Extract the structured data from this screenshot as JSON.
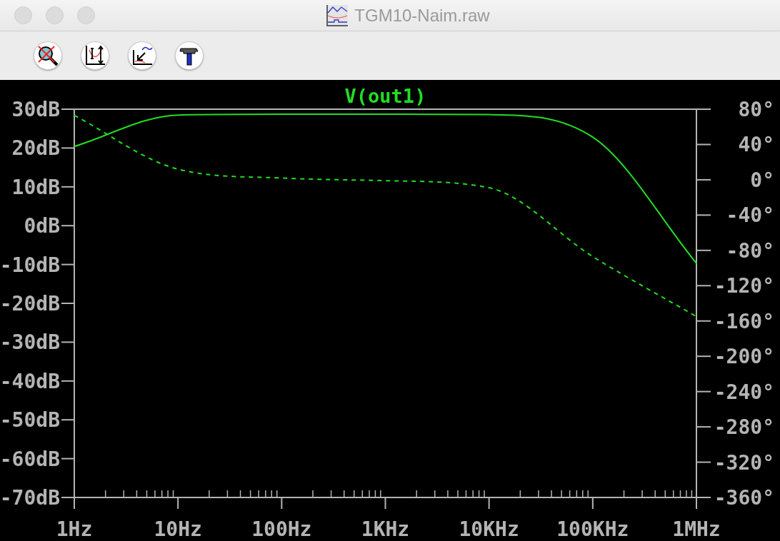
{
  "window": {
    "title": "TGM10-Naim.raw"
  },
  "toolbar": {
    "buttons": [
      {
        "kind": "zoom-cancel"
      },
      {
        "kind": "autorange"
      },
      {
        "kind": "zoom-back"
      },
      {
        "kind": "hammer"
      }
    ]
  },
  "plot": {
    "chart_data": {
      "type": "line",
      "title": "V(out1)",
      "categories": [
        "1Hz",
        "10Hz",
        "100Hz",
        "1KHz",
        "10KHz",
        "100KHz",
        "1MHz"
      ],
      "series": [
        {
          "color": "#22dd22",
          "line_style": "solid",
          "values": [
            20.4,
            28.5,
            28.7,
            28.7,
            28.6,
            22.8,
            -9.7
          ]
        },
        {
          "color": "#22dd22",
          "line_style": "dashed",
          "axis": "y2",
          "values": [
            73,
            12,
            2,
            -1,
            -9,
            -87,
            -155
          ]
        }
      ],
      "ylim": [
        -70,
        30
      ],
      "yticks": [
        {
          "value": 30,
          "label": "30dB"
        },
        {
          "value": 20,
          "label": "20dB"
        },
        {
          "value": 10,
          "label": "10dB"
        },
        {
          "value": 0,
          "label": "0dB"
        },
        {
          "value": -10,
          "label": "-10dB"
        },
        {
          "value": -20,
          "label": "-20dB"
        },
        {
          "value": -30,
          "label": "-30dB"
        },
        {
          "value": -40,
          "label": "-40dB"
        },
        {
          "value": -50,
          "label": "-50dB"
        },
        {
          "value": -60,
          "label": "-60dB"
        },
        {
          "value": -70,
          "label": "-70dB"
        }
      ],
      "y2lim": [
        -360,
        80
      ],
      "y2ticks": [
        {
          "value": 80,
          "label": "80°"
        },
        {
          "value": 40,
          "label": "40°"
        },
        {
          "value": 0,
          "label": "0°"
        },
        {
          "value": -40,
          "label": "-40°"
        },
        {
          "value": -80,
          "label": "-80°"
        },
        {
          "value": -120,
          "label": "-120°"
        },
        {
          "value": -160,
          "label": "-160°"
        },
        {
          "value": -200,
          "label": "-200°"
        },
        {
          "value": -240,
          "label": "-240°"
        },
        {
          "value": -280,
          "label": "-280°"
        },
        {
          "value": -320,
          "label": "-320°"
        },
        {
          "value": -360,
          "label": "-360°"
        }
      ]
    }
  }
}
